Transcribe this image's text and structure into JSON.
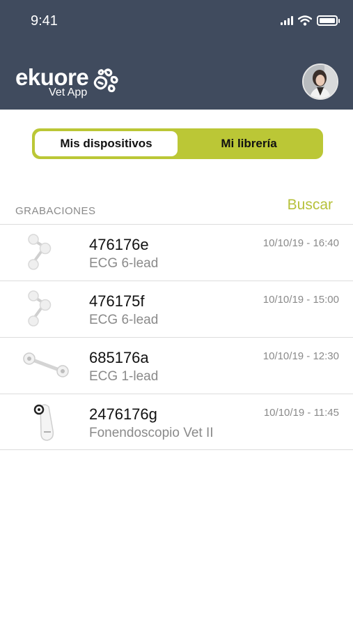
{
  "status_bar": {
    "time": "9:41",
    "icons": [
      "cellular-signal-icon",
      "wifi-icon",
      "battery-icon"
    ]
  },
  "header": {
    "logo_name": "ekuore",
    "logo_subtitle": "Vet App",
    "background_color": "#404b5e"
  },
  "segment": {
    "tabs": [
      {
        "label": "Mis dispositivos",
        "active": true
      },
      {
        "label": "Mi librería",
        "active": false
      }
    ],
    "accent_color": "#bbc736"
  },
  "section": {
    "label": "GRABACIONES",
    "search_label": "Buscar"
  },
  "recordings": [
    {
      "id": "476176e",
      "device": "ECG 6-lead",
      "date": "10/10/19 - 16:40",
      "icon": "ecg-6-lead-icon"
    },
    {
      "id": "476175f",
      "device": "ECG 6-lead",
      "date": "10/10/19 - 15:00",
      "icon": "ecg-6-lead-icon"
    },
    {
      "id": "685176a",
      "device": "ECG 1-lead",
      "date": "10/10/19 - 12:30",
      "icon": "ecg-1-lead-icon"
    },
    {
      "id": "2476176g",
      "device": "Fonendoscopio Vet II",
      "date": "10/10/19 - 11:45",
      "icon": "stethoscope-icon"
    }
  ]
}
